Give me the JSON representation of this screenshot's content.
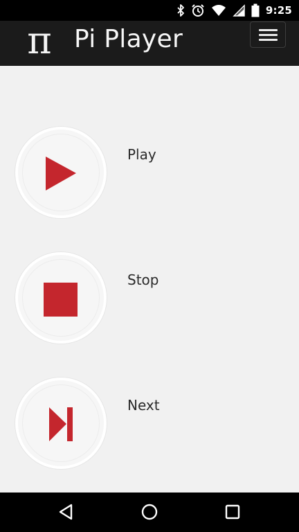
{
  "status_bar": {
    "time": "9:25",
    "icons": [
      "bluetooth-icon",
      "alarm-icon",
      "wifi-icon",
      "signal-icon",
      "battery-icon"
    ]
  },
  "header": {
    "logo_text": "π",
    "title": "Pi Player",
    "menu_icon": "hamburger-menu-icon"
  },
  "controls": [
    {
      "label": "Play",
      "icon": "play-icon"
    },
    {
      "label": "Stop",
      "icon": "stop-icon"
    },
    {
      "label": "Next",
      "icon": "skip-next-icon"
    }
  ],
  "nav_bar": {
    "icons": [
      "back-icon",
      "home-icon",
      "recents-icon"
    ]
  },
  "colors": {
    "accent": "#c4262d",
    "header_bg": "#1b1b1b",
    "page_bg": "#f1f1f1"
  }
}
